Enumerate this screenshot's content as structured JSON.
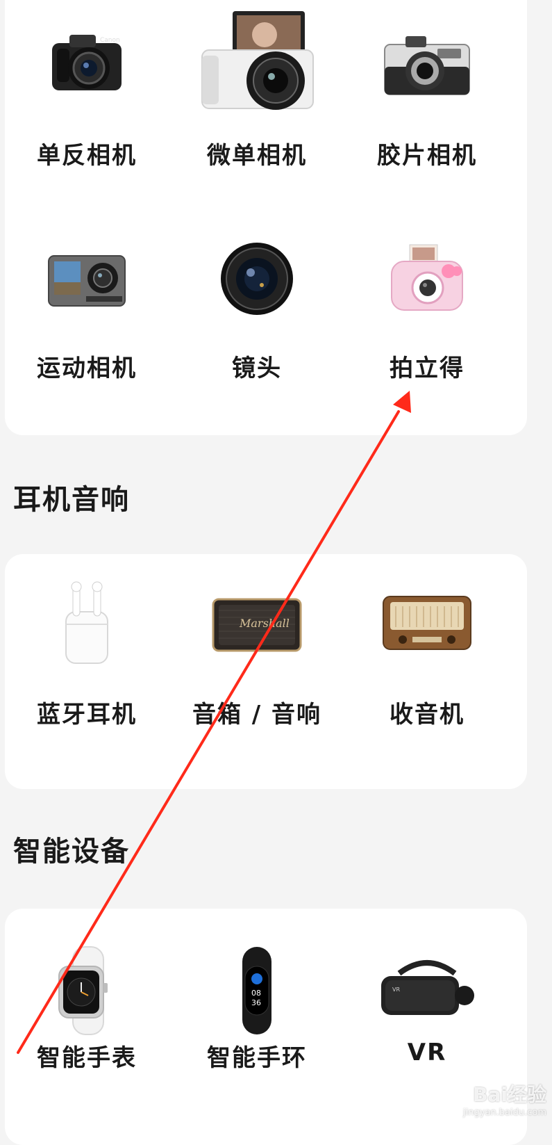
{
  "sections": [
    {
      "title": ""
    },
    {
      "title": "耳机音响"
    },
    {
      "title": "智能设备"
    }
  ],
  "items": {
    "dslr": {
      "label": "单反相机",
      "icon": "dslr-camera-icon"
    },
    "mirrorless": {
      "label": "微单相机",
      "icon": "mirrorless-camera-icon"
    },
    "film": {
      "label": "胶片相机",
      "icon": "film-camera-icon"
    },
    "action": {
      "label": "运动相机",
      "icon": "action-camera-icon"
    },
    "lens": {
      "label": "镜头",
      "icon": "lens-icon"
    },
    "instant": {
      "label": "拍立得",
      "icon": "instant-camera-icon"
    },
    "earbuds": {
      "label": "蓝牙耳机",
      "icon": "earbuds-icon"
    },
    "speaker": {
      "label": "音箱 / 音响",
      "icon": "speaker-icon"
    },
    "radio": {
      "label": "收音机",
      "icon": "radio-icon"
    },
    "watch": {
      "label": "智能手表",
      "icon": "smartwatch-icon"
    },
    "band": {
      "label": "智能手环",
      "icon": "fitness-band-icon"
    },
    "vr": {
      "label": "VR",
      "icon": "vr-headset-icon"
    }
  },
  "annotation": {
    "color": "#ff2a1a"
  },
  "watermark": {
    "line1": "Bai经验",
    "line2": "jingyan.baidu.com"
  }
}
